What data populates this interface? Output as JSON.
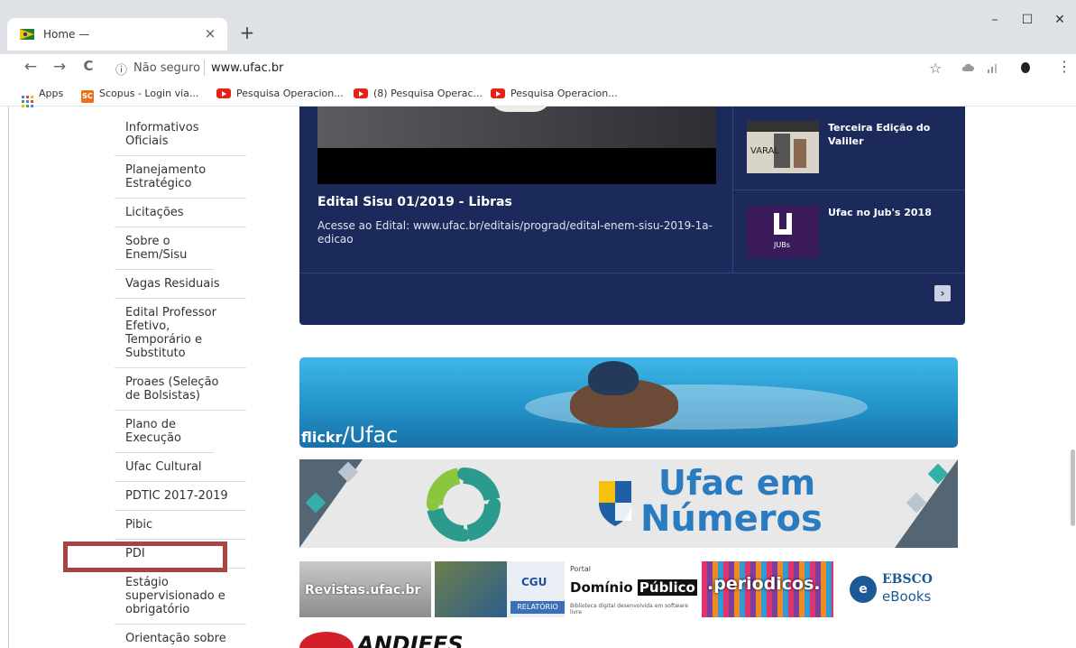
{
  "browser": {
    "tab_title": "Home —",
    "tab_close": "×",
    "new_tab": "+",
    "window_controls": [
      "–",
      "☐",
      "✕"
    ],
    "nav": {
      "back": "←",
      "forward": "→",
      "reload": "C"
    },
    "address": {
      "info_icon": "ⓘ",
      "security_text": "Não seguro",
      "url": "www.ufac.br"
    },
    "star_icon": "☆",
    "menu_icon": "⋮"
  },
  "bookmarks": [
    {
      "label": "Apps",
      "icon": "apps-grid-icon"
    },
    {
      "label": "Scopus - Login via...",
      "icon": "scopus-icon",
      "badge": "SC"
    },
    {
      "label": "Pesquisa Operacion...",
      "icon": "youtube-icon"
    },
    {
      "label": "(8) Pesquisa Operac...",
      "icon": "youtube-icon"
    },
    {
      "label": "Pesquisa Operacion...",
      "icon": "youtube-icon"
    }
  ],
  "sidebar": {
    "items": [
      "Informativos Oficiais",
      "Planejamento Estratégico",
      "Licitações",
      "Sobre o Enem/Sisu",
      "Vagas Residuais",
      "Edital Professor Efetivo, Temporário e Substituto",
      "Proaes (Seleção de Bolsistas)",
      "Plano de Execução",
      "Ufac Cultural",
      "PDTIC 2017-2019",
      "Pibic",
      "PDI",
      "Estágio supervisionado e obrigatório",
      "Orientação sobre"
    ]
  },
  "news": {
    "headline": "Edital Sisu 01/2019 - Libras",
    "description": "Acesse ao Edital: www.ufac.br/editais/prograd/edital-enem-sisu-2019-1a-edicao",
    "side": [
      {
        "title": "Terceira Edição do Valiler"
      },
      {
        "title": "Ufac no Jub's 2018"
      }
    ],
    "next": "›"
  },
  "banners": {
    "flickr_prefix": "flickr",
    "flickr_suffix": "/Ufac",
    "numeros_line1": "Ufac em",
    "numeros_line2": "Números"
  },
  "logos": {
    "revistas": "Revistas.ufac.br",
    "cgu": "CGU",
    "cgu_relatorio": "RELATÓRIO",
    "dominio_portal": "Portal",
    "dominio_1": "Domínio",
    "dominio_2": "Público",
    "dominio_sub": "Biblioteca digital desenvolvida em software livre",
    "periodicos": ".periodicos.",
    "ebsco_1": "EBSCO",
    "ebsco_2": "eBooks",
    "andifes": "ANDIFES"
  },
  "colors": {
    "news_bg": "#1c2a5b",
    "brand_blue": "#2b7bc0",
    "highlight": "#a94442"
  }
}
